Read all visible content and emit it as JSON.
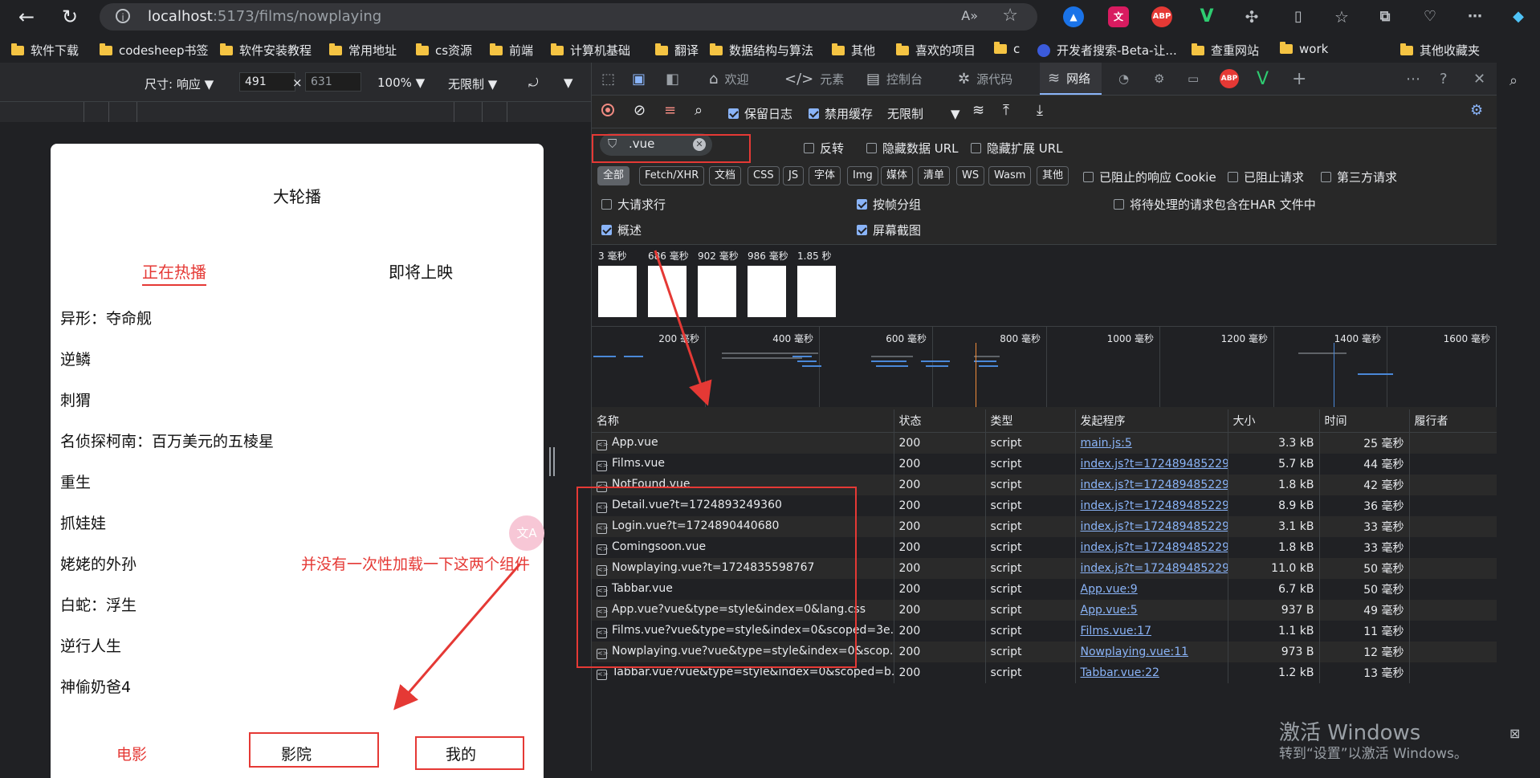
{
  "browser": {
    "url_host": "localhost",
    "url_path": ":5173/films/nowplaying",
    "extensions": [
      "ABP",
      "V"
    ],
    "bookmarks": [
      "软件下载",
      "codesheep书签",
      "软件安装教程",
      "常用地址",
      "cs资源",
      "前端",
      "计算机基础",
      "翻译",
      "数据结构与算法",
      "其他",
      "喜欢的项目",
      "c",
      "开发者搜索-Beta-让...",
      "查重网站",
      "work",
      "其他收藏夹"
    ]
  },
  "device": {
    "size_label": "尺寸: 响应",
    "width": "491",
    "times": "×",
    "height": "631",
    "zoom": "100%",
    "throttle": "无限制"
  },
  "app": {
    "banner": "大轮播",
    "tabs": [
      "正在热播",
      "即将上映"
    ],
    "films": [
      "异形：夺命舰",
      "逆鳞",
      "刺猬",
      "名侦探柯南：百万美元的五棱星",
      "重生",
      "抓娃娃",
      "姥姥的外孙",
      "白蛇：浮生",
      "逆行人生",
      "神偷奶爸4"
    ],
    "footer": [
      "电影",
      "影院",
      "我的"
    ]
  },
  "annotation": {
    "text": "并没有一次性加载一下这两个组件",
    "color": "#e53935"
  },
  "devtools": {
    "tabs": [
      "欢迎",
      "元素",
      "控制台",
      "源代码",
      "网络"
    ],
    "toolbar": {
      "preserve_log": "保留日志",
      "disable_cache": "禁用缓存",
      "throttle": "无限制"
    },
    "filter": {
      "value": ".vue",
      "invert": "反转",
      "hide_data_url": "隐藏数据 URL",
      "hide_ext_url": "隐藏扩展 URL"
    },
    "types": [
      "全部",
      "Fetch/XHR",
      "文档",
      "CSS",
      "JS",
      "字体",
      "Img",
      "媒体",
      "清单",
      "WS",
      "Wasm",
      "其他"
    ],
    "type_checks": [
      "已阻止的响应 Cookie",
      "已阻止请求",
      "第三方请求"
    ],
    "options": {
      "big_rows": "大请求行",
      "group_by_frame": "按帧分组",
      "har_option": "将待处理的请求包含在HAR 文件中",
      "overview": "概述",
      "screenshots": "屏幕截图"
    },
    "screenshot_times": [
      "3 毫秒",
      "686 毫秒",
      "902 毫秒",
      "986 毫秒",
      "1.85 秒"
    ],
    "timeline_ticks": [
      "200 毫秒",
      "400 毫秒",
      "600 毫秒",
      "800 毫秒",
      "1000 毫秒",
      "1200 毫秒",
      "1400 毫秒",
      "1600 毫秒"
    ],
    "columns": [
      "名称",
      "状态",
      "类型",
      "发起程序",
      "大小",
      "时间",
      "履行者"
    ],
    "rows": [
      {
        "name": "App.vue",
        "status": "200",
        "type": "script",
        "initiator": "main.js:5",
        "size": "3.3 kB",
        "time": "25 毫秒"
      },
      {
        "name": "Films.vue",
        "status": "200",
        "type": "script",
        "initiator": "index.js?t=1724894852298:",
        "size": "5.7 kB",
        "time": "44 毫秒"
      },
      {
        "name": "NotFound.vue",
        "status": "200",
        "type": "script",
        "initiator": "index.js?t=1724894852298:",
        "size": "1.8 kB",
        "time": "42 毫秒"
      },
      {
        "name": "Detail.vue?t=1724893249360",
        "status": "200",
        "type": "script",
        "initiator": "index.js?t=1724894852298:",
        "size": "8.9 kB",
        "time": "36 毫秒"
      },
      {
        "name": "Login.vue?t=1724890440680",
        "status": "200",
        "type": "script",
        "initiator": "index.js?t=1724894852298:",
        "size": "3.1 kB",
        "time": "33 毫秒"
      },
      {
        "name": "Comingsoon.vue",
        "status": "200",
        "type": "script",
        "initiator": "index.js?t=1724894852298:",
        "size": "1.8 kB",
        "time": "33 毫秒"
      },
      {
        "name": "Nowplaying.vue?t=1724835598767",
        "status": "200",
        "type": "script",
        "initiator": "index.js?t=1724894852298:",
        "size": "11.0 kB",
        "time": "50 毫秒"
      },
      {
        "name": "Tabbar.vue",
        "status": "200",
        "type": "script",
        "initiator": "App.vue:9",
        "size": "6.7 kB",
        "time": "50 毫秒"
      },
      {
        "name": "App.vue?vue&type=style&index=0&lang.css",
        "status": "200",
        "type": "script",
        "initiator": "App.vue:5",
        "size": "937 B",
        "time": "49 毫秒"
      },
      {
        "name": "Films.vue?vue&type=style&index=0&scoped=3e...",
        "status": "200",
        "type": "script",
        "initiator": "Films.vue:17",
        "size": "1.1 kB",
        "time": "11 毫秒"
      },
      {
        "name": "Nowplaying.vue?vue&type=style&index=0&scop...",
        "status": "200",
        "type": "script",
        "initiator": "Nowplaying.vue:11",
        "size": "973 B",
        "time": "12 毫秒"
      },
      {
        "name": "Tabbar.vue?vue&type=style&index=0&scoped=b...",
        "status": "200",
        "type": "script",
        "initiator": "Tabbar.vue:22",
        "size": "1.2 kB",
        "time": "13 毫秒"
      }
    ]
  },
  "watermark": {
    "title": "激活 Windows",
    "subtitle": "转到“设置”以激活 Windows。"
  }
}
